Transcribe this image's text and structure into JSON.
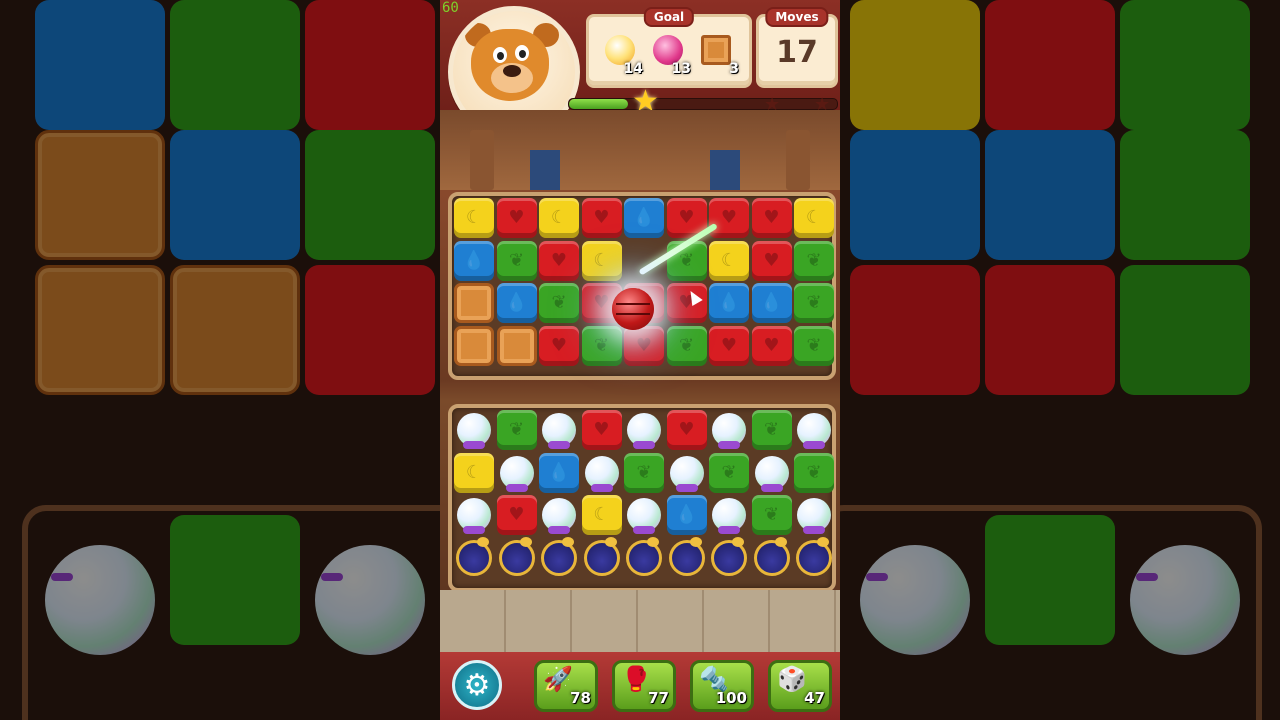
{
  "hud": {
    "fps": "60",
    "goal_label": "Goal",
    "moves_label": "Moves",
    "moves_left": "17",
    "goals": [
      {
        "icon": "sun-orb-icon",
        "count": "14"
      },
      {
        "icon": "pink-ball-icon",
        "count": "13"
      },
      {
        "icon": "crate-icon",
        "count": "3"
      }
    ],
    "progress_fraction": 0.22,
    "stars_earned": 1,
    "stars_total": 3
  },
  "boosters": [
    {
      "name": "hammer-rocket-booster",
      "icon": "rocket-icon",
      "count": "78"
    },
    {
      "name": "boxing-glove-booster",
      "icon": "boxing-glove-icon",
      "count": "77"
    },
    {
      "name": "drill-booster",
      "icon": "drill-icon",
      "count": "100"
    },
    {
      "name": "dice-booster",
      "icon": "dice-icon",
      "count": "47"
    }
  ],
  "top_board": [
    [
      "yellow-moon",
      "red-heart",
      "yellow-moon",
      "red-heart",
      "blue-drop",
      "red-heart",
      "red-heart",
      "red-heart",
      "yellow-moon"
    ],
    [
      "blue-drop",
      "green-leaf",
      "red-heart",
      "yellow-moon",
      "empty",
      "green-leaf",
      "yellow-moon",
      "red-heart",
      "green-leaf"
    ],
    [
      "crate",
      "blue-drop",
      "green-leaf",
      "red-heart",
      "red-heart",
      "red-heart",
      "blue-drop",
      "blue-drop",
      "green-leaf"
    ],
    [
      "crate",
      "crate",
      "red-heart",
      "green-leaf",
      "red-heart",
      "green-leaf",
      "red-heart",
      "red-heart",
      "green-leaf"
    ]
  ],
  "bottom_board": [
    [
      "pearl",
      "green-leaf",
      "pearl",
      "red-heart",
      "pearl",
      "red-heart",
      "pearl",
      "green-leaf",
      "pearl"
    ],
    [
      "yellow-moon",
      "pearl",
      "blue-drop",
      "pearl",
      "green-leaf",
      "pearl",
      "green-leaf",
      "pearl",
      "green-leaf"
    ],
    [
      "pearl",
      "red-heart",
      "pearl",
      "yellow-moon",
      "pearl",
      "blue-drop",
      "pearl",
      "green-leaf",
      "pearl"
    ],
    [
      "pot",
      "pot",
      "pot",
      "pot",
      "pot",
      "pot",
      "pot",
      "pot",
      "pot"
    ]
  ],
  "colors": {
    "red": "#d81d22",
    "yellow": "#f4d21c",
    "blue": "#1f7fd2",
    "green": "#3aa524",
    "hud_red": "#8c2f25"
  }
}
